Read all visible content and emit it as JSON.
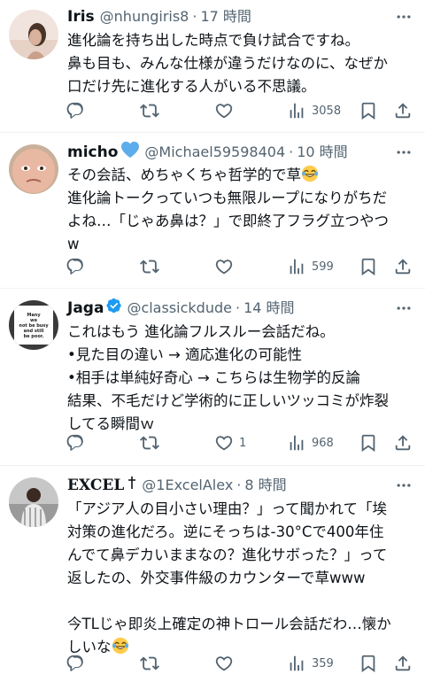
{
  "tweets": [
    {
      "name": "Iris",
      "handle": "@nhungiris8",
      "time": "17 時間",
      "lines": [
        "進化論を持ち出した時点で負け試合ですね。",
        "鼻も目も、みんな仕様が違うだけなのに、なぜか",
        "口だけ先に進化する人がいる不思議。"
      ],
      "views": "3058",
      "likes": ""
    },
    {
      "name": "micho",
      "handle": "@Michael59598404",
      "time": "10 時間",
      "lines": [
        "その会話、めちゃくちゃ哲学的で草",
        "進化論トークっていつも無限ループになりがちだ",
        "よね…「じゃあ鼻は？」で即終了フラグ立つやつ",
        "w"
      ],
      "views": "599",
      "likes": ""
    },
    {
      "name": "Jaga",
      "handle": "@classickdude",
      "time": "14 時間",
      "avatar_text": [
        "Many",
        "we",
        "not be busy",
        "and still",
        "be poor."
      ],
      "lines": [
        "これはもう 進化論フルスルー会話だね。",
        "•見た目の違い → 適応進化の可能性",
        "•相手は単純好奇心 → こちらは生物学的反論",
        "結果、不毛だけど学術的に正しいツッコミが炸裂",
        "してる瞬間ｗ"
      ],
      "views": "968",
      "likes": "1"
    },
    {
      "name": "EXCEL",
      "handle": "@1ExcelAlex",
      "time": "8 時間",
      "lines": [
        "「アジア人の目小さい理由？」って聞かれて「埃",
        "対策の進化だろ。逆にそっちは-30°Cで400年住",
        "んでて鼻デカいままなの？進化サボった？」って",
        "返したの、外交事件級のカウンターで草www",
        "",
        "今TLじゃ即炎上確定の神トロール会話だわ…懐か",
        "しいな"
      ],
      "views": "359",
      "likes": ""
    }
  ],
  "separator": "·",
  "icons": {
    "reply": "reply-icon",
    "retweet": "retweet-icon",
    "like": "heart-icon",
    "views": "views-icon",
    "bookmark": "bookmark-icon",
    "share": "share-icon",
    "more": "more-icon",
    "verified": "verified-badge-icon",
    "blue_heart": "blue-heart-emoji",
    "laughing": "laughing-emoji",
    "dagger": "dagger-icon"
  },
  "colors": {
    "text": "#0f1419",
    "secondary": "#536471",
    "verified": "#1d9bf0",
    "divider": "#eff3f4"
  }
}
